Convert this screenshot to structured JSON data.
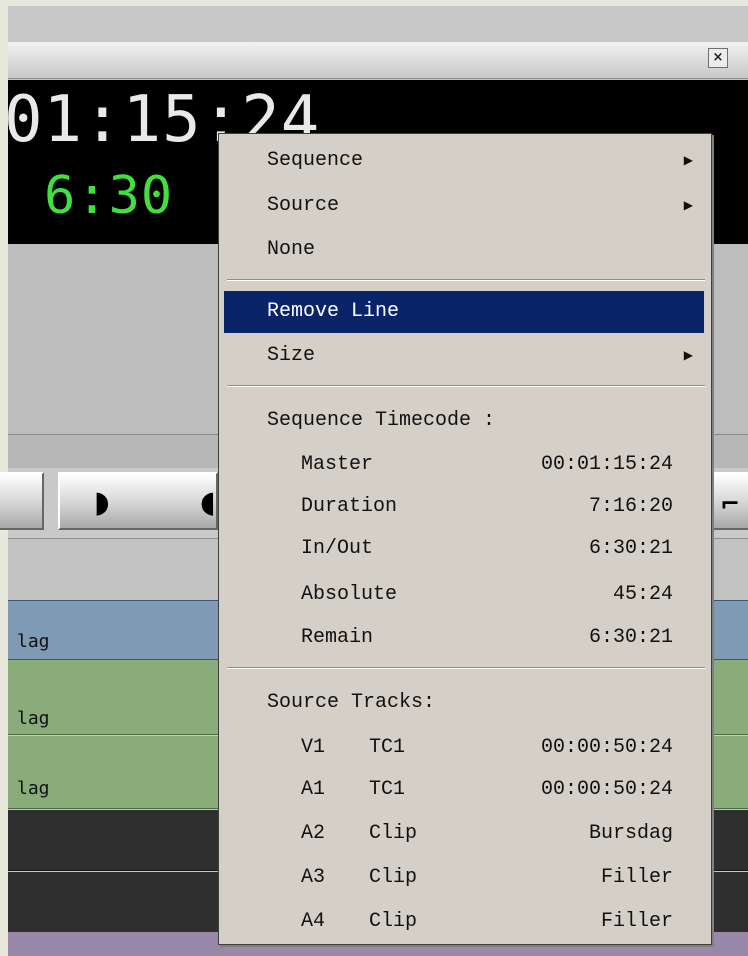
{
  "window": {
    "close_glyph": "×"
  },
  "timecode": {
    "master_display": "01:15:24",
    "inout_display": "6:30"
  },
  "tracks": [
    {
      "label": "lag"
    },
    {
      "label": "lag"
    },
    {
      "label": "lag"
    }
  ],
  "menu": {
    "items": [
      {
        "label": "Sequence",
        "has_submenu": true
      },
      {
        "label": "Source",
        "has_submenu": true
      },
      {
        "label": "None",
        "has_submenu": false
      }
    ],
    "remove_line": "Remove Line",
    "size": "Size",
    "submenu_arrow": "▶",
    "sequence_timecode_header": "Sequence Timecode :",
    "sequence_timecode": [
      {
        "name": "Master",
        "value": "00:01:15:24"
      },
      {
        "name": "Duration",
        "value": "7:16:20"
      },
      {
        "name": "In/Out",
        "value": "6:30:21"
      },
      {
        "name": "Absolute",
        "value": "45:24"
      },
      {
        "name": "Remain",
        "value": "6:30:21"
      }
    ],
    "source_tracks_header": "Source Tracks:",
    "source_tracks": [
      {
        "track": "V1",
        "type": "TC1",
        "value": "00:00:50:24"
      },
      {
        "track": "A1",
        "type": "TC1",
        "value": "00:00:50:24"
      },
      {
        "track": "A2",
        "type": "Clip",
        "value": "Bursdag"
      },
      {
        "track": "A3",
        "type": "Clip",
        "value": "Filler"
      },
      {
        "track": "A4",
        "type": "Clip",
        "value": "Filler"
      }
    ]
  },
  "colors": {
    "menu_highlight": "#0a246a",
    "inout_timecode": "#3fe03f",
    "track_video": "#7e9ab4",
    "track_audio": "#8aab7a"
  }
}
